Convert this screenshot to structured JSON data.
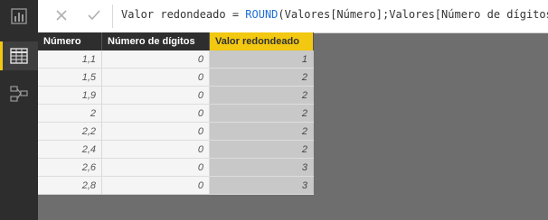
{
  "sidebar": {
    "items": [
      {
        "icon": "report-view-icon",
        "active": false
      },
      {
        "icon": "data-view-icon",
        "active": true
      },
      {
        "icon": "relationships-view-icon",
        "active": false
      }
    ]
  },
  "formula_bar": {
    "cancel_icon": "close-icon",
    "commit_icon": "check-icon",
    "measure_prefix": "Valor redondeado = ",
    "function_name": "ROUND",
    "arguments": "(Valores[Número];Valores[Número de dígitos])"
  },
  "table": {
    "headers": [
      "Número",
      "Número de dígitos",
      "Valor redondeado"
    ],
    "selected_column": 2,
    "rows": [
      [
        "1,1",
        "0",
        "1"
      ],
      [
        "1,5",
        "0",
        "2"
      ],
      [
        "1,9",
        "0",
        "2"
      ],
      [
        "2",
        "0",
        "2"
      ],
      [
        "2,2",
        "0",
        "2"
      ],
      [
        "2,4",
        "0",
        "2"
      ],
      [
        "2,6",
        "0",
        "3"
      ],
      [
        "2,8",
        "0",
        "3"
      ]
    ]
  },
  "colors": {
    "accent": "#f2c811",
    "sidebar": "#2d2d2d",
    "canvas": "#6e6e6e",
    "function": "#1e6ed8"
  }
}
